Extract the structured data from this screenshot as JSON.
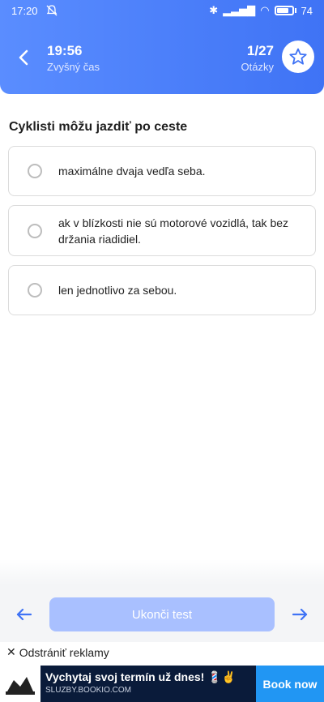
{
  "status": {
    "time": "17:20",
    "battery": "74"
  },
  "header": {
    "timer_value": "19:56",
    "timer_label": "Zvyšný čas",
    "question_counter": "1/27",
    "question_label": "Otázky"
  },
  "question": {
    "text": "Cyklisti môžu jazdiť po ceste",
    "answers": [
      "maximálne dvaja vedľa seba.",
      "ak v blízkosti nie sú motorové vozidlá, tak bez držania riadidiel.",
      "len jednotlivo za sebou."
    ]
  },
  "bottom": {
    "finish_label": "Ukonči test",
    "remove_ads_label": "Odstrániť reklamy"
  },
  "ad": {
    "title": "Vychytaj svoj termín už dnes! 💈✌",
    "subtitle": "SLUZBY.BOOKIO.COM",
    "cta": "Book now"
  },
  "colors": {
    "accent": "#4a7cf7",
    "finish_disabled": "#a9c0ff",
    "ad_cta": "#2196f3"
  }
}
